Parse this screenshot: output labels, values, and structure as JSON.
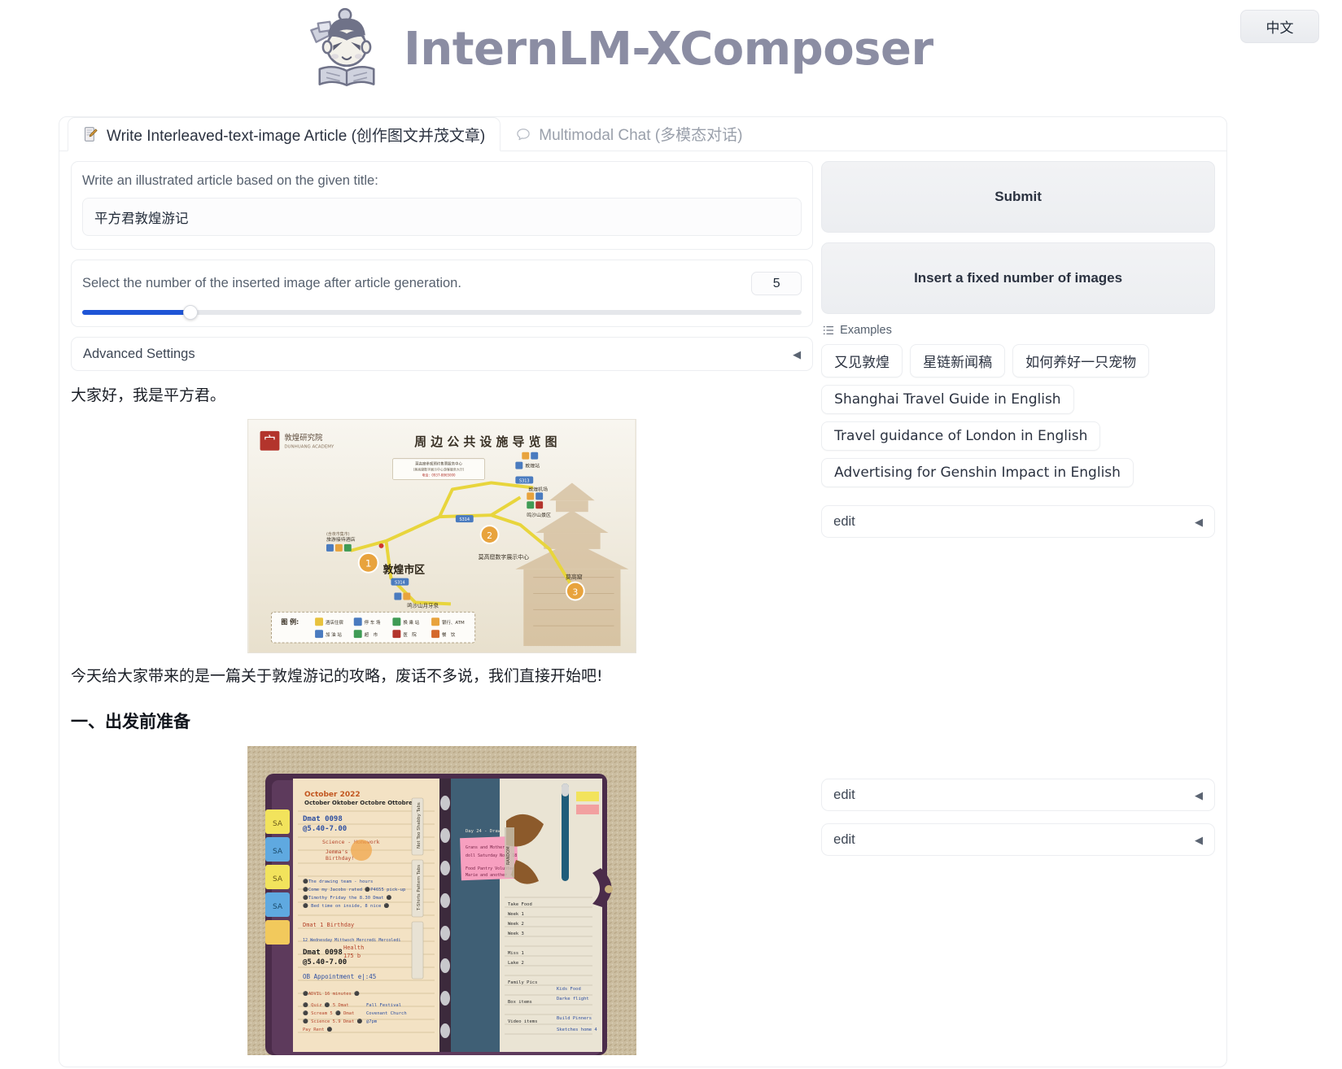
{
  "header": {
    "title": "InternLM-XComposer",
    "logo_icon": "xcomposer-mascot-logo",
    "language_button": "中文"
  },
  "tabs": [
    {
      "label": "Write Interleaved-text-image Article (创作图文并茂文章)",
      "icon": "memo-pencil-icon",
      "active": true
    },
    {
      "label": "Multimodal Chat (多模态对话)",
      "icon": "speech-bubble-icon",
      "active": false
    }
  ],
  "form": {
    "title_label": "Write an illustrated article based on the given title:",
    "title_value": "平方君敦煌游记",
    "title_placeholder": "",
    "slider_label": "Select the number of the inserted image after article generation.",
    "slider_value": "5",
    "slider_min": 0,
    "slider_max": 30,
    "advanced_settings_label": "Advanced Settings",
    "collapse_caret": "◀"
  },
  "actions": {
    "submit_label": "Submit",
    "insert_images_label": "Insert a fixed number of images"
  },
  "examples": {
    "heading": "Examples",
    "list_icon": "list-icon",
    "items": [
      "又见敦煌",
      "星链新闻稿",
      "如何养好一只宠物",
      "Shanghai Travel Guide in English",
      "Travel guidance of London in English",
      "Advertising for Genshin Impact in English"
    ]
  },
  "edit_panels": [
    {
      "label": "edit",
      "caret": "◀"
    },
    {
      "label": "edit",
      "caret": "◀"
    },
    {
      "label": "edit",
      "caret": "◀"
    }
  ],
  "article": {
    "paragraph_1": "大家好，我是平方君。",
    "image_1": {
      "name": "dunhuang-public-facilities-map",
      "academy_label": "敦煌研究院",
      "academy_sub": "DUNHUANG ACADEMY",
      "map_title": "周 边 公 共 设 施 导 览 图",
      "marker_1": "敦煌市区",
      "marker_2": "莫高窟数字展示中心",
      "station_label": "敦煌站",
      "airport_label": "敦煌机场",
      "site_label": "莫高窟",
      "spring_label": "鸣沙山月牙泉",
      "hotel_label": "旅游接待酒店",
      "visitor_center": "莫高窟数字展示中心",
      "road_1": "S314",
      "road_2": "S314",
      "road_3": "S313",
      "legend_title": "图 例:",
      "legend_items": [
        "酒店住宿",
        "停 车 场",
        "换 乘 站",
        "银行、ATM",
        "加 油 站",
        "超 市",
        "医 院",
        "餐 饮"
      ]
    },
    "paragraph_2": "今天给大家带来的是一篇关于敦煌游记的攻略，废话不多说，我们直接开始吧!",
    "heading_1": "一、出发前准备",
    "image_2": {
      "name": "travel-planner-notebook-photo",
      "month_label": "October 2022",
      "caption": ""
    }
  }
}
